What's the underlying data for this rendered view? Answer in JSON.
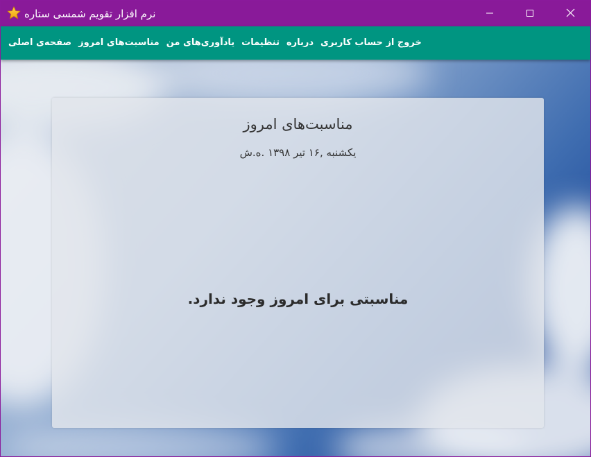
{
  "window": {
    "title": "نرم افزار تقویم شمسی ستاره",
    "app_icon": "star-icon",
    "controls": [
      "minimize-icon",
      "maximize-icon",
      "close-icon"
    ]
  },
  "nav": {
    "items": [
      {
        "label": "صفحه‌ی اصلی"
      },
      {
        "label": "مناسبت‌های امروز"
      },
      {
        "label": "یادآوری‌های من"
      },
      {
        "label": "تنظیمات"
      },
      {
        "label": "درباره"
      },
      {
        "label": "خروج از حساب کاربری"
      }
    ]
  },
  "main": {
    "title": "مناسبت‌های امروز",
    "date": "یکشنبه ,۱۶ تیر ۱۳۹۸ .ه.ش",
    "empty_message": "مناسبتی برای امروز وجود ندارد."
  },
  "colors": {
    "titlebar": "#891a99",
    "navbar": "#009581",
    "nav_text": "#ffffff"
  }
}
